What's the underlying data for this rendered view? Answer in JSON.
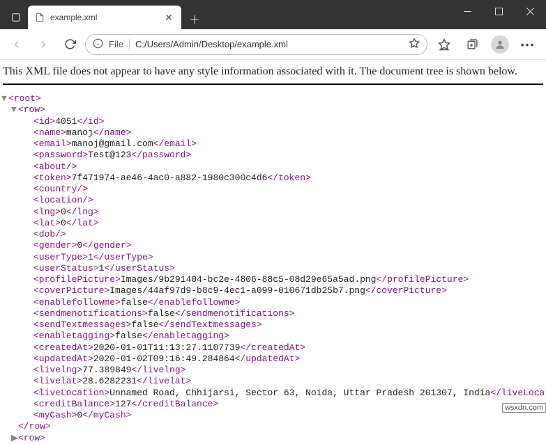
{
  "browser": {
    "tab_title": "example.xml",
    "url_scheme_label": "File",
    "url_path": "C:/Users/Admin/Desktop/example.xml"
  },
  "notice": "This XML file does not appear to have any style information associated with it. The document tree is shown below.",
  "xml": {
    "root_open": "<root>",
    "row_open": "<row>",
    "fields": [
      {
        "name": "id",
        "value": "4051",
        "self_close": false
      },
      {
        "name": "name",
        "value": "manoj",
        "self_close": false
      },
      {
        "name": "email",
        "value": "manoj@gmail.com",
        "self_close": false
      },
      {
        "name": "password",
        "value": "Test@123",
        "self_close": false
      },
      {
        "name": "about",
        "value": "",
        "self_close": true
      },
      {
        "name": "token",
        "value": "7f471974-ae46-4ac0-a882-1980c300c4d6",
        "self_close": false
      },
      {
        "name": "country",
        "value": "",
        "self_close": true
      },
      {
        "name": "location",
        "value": "",
        "self_close": true
      },
      {
        "name": "lng",
        "value": "0",
        "self_close": false
      },
      {
        "name": "lat",
        "value": "0",
        "self_close": false
      },
      {
        "name": "dob",
        "value": "",
        "self_close": true
      },
      {
        "name": "gender",
        "value": "0",
        "self_close": false
      },
      {
        "name": "userType",
        "value": "1",
        "self_close": false
      },
      {
        "name": "userStatus",
        "value": "1",
        "self_close": false
      },
      {
        "name": "profilePicture",
        "value": "Images/9b291404-bc2e-4806-88c5-08d29e65a5ad.png",
        "self_close": false
      },
      {
        "name": "coverPicture",
        "value": "Images/44af97d9-b8c9-4ec1-a099-010671db25b7.png",
        "self_close": false
      },
      {
        "name": "enablefollowme",
        "value": "false",
        "self_close": false
      },
      {
        "name": "sendmenotifications",
        "value": "false",
        "self_close": false
      },
      {
        "name": "sendTextmessages",
        "value": "false",
        "self_close": false
      },
      {
        "name": "enabletagging",
        "value": "false",
        "self_close": false
      },
      {
        "name": "createdAt",
        "value": "2020-01-01T11:13:27.1107739",
        "self_close": false
      },
      {
        "name": "updatedAt",
        "value": "2020-01-02T09:16:49.284864",
        "self_close": false
      },
      {
        "name": "livelng",
        "value": "77.389849",
        "self_close": false
      },
      {
        "name": "livelat",
        "value": "28.6282231",
        "self_close": false
      },
      {
        "name": "liveLocation",
        "value": "Unnamed Road, Chhijarsi, Sector 63, Noida, Uttar Pradesh 201307, India",
        "self_close": false
      },
      {
        "name": "creditBalance",
        "value": "127",
        "self_close": false
      },
      {
        "name": "myCash",
        "value": "0",
        "self_close": false
      }
    ],
    "row_close": "</row>",
    "row2_open": "<row>"
  },
  "watermark": "wsxdn.com"
}
